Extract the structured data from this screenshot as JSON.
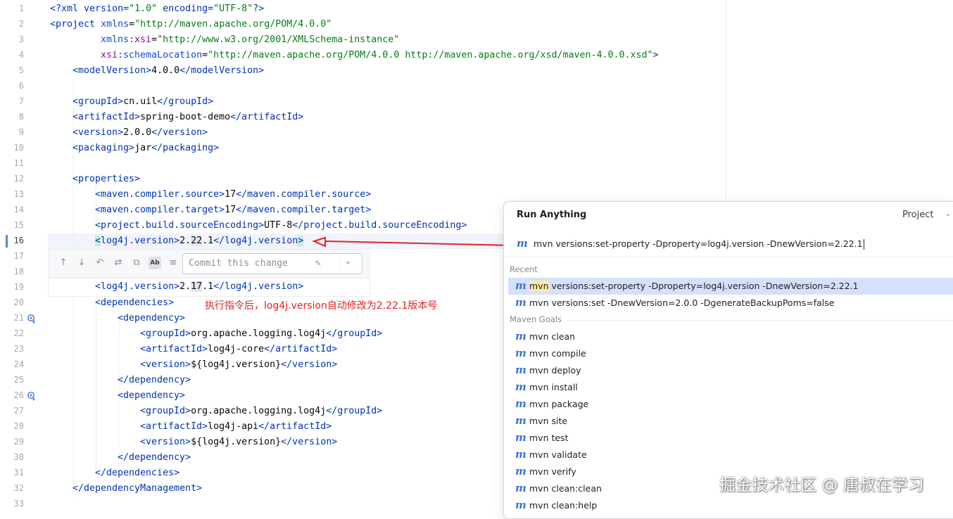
{
  "gutter": {
    "line_numbers": [
      "1",
      "2",
      "3",
      "4",
      "5",
      "6",
      "7",
      "8",
      "9",
      "10",
      "11",
      "12",
      "13",
      "14",
      "15",
      "16",
      "17",
      "18",
      "19",
      "20",
      "21",
      "22",
      "23",
      "24",
      "25",
      "26",
      "27",
      "28",
      "29",
      "30",
      "31",
      "32",
      "33"
    ],
    "current_line": "16"
  },
  "code": {
    "l1": {
      "p1": "<?xml version=",
      "p2": "\"1.0\"",
      "p3": " encoding=",
      "p4": "\"UTF-8\"",
      "p5": "?>"
    },
    "l2": {
      "p1": "<project ",
      "p2": "xmlns",
      "p3": "=",
      "p4": "\"http://maven.apache.org/POM/4.0.0\""
    },
    "l3": {
      "p1": "xmlns",
      "p2": ":xsi",
      "p3": "=",
      "p4": "\"http://www.w3.org/2001/XMLSchema-instance\""
    },
    "l4": {
      "p1": "xsi",
      "p2": ":schemaLocation",
      "p3": "=",
      "p4": "\"http://maven.apache.org/POM/4.0.0 http://maven.apache.org/xsd/maven-4.0.0.xsd\"",
      "p5": ">"
    },
    "l5": {
      "p1": "<modelVersion>",
      "p2": "4.0.0",
      "p3": "</modelVersion>"
    },
    "l7": {
      "p1": "<groupId>",
      "p2": "cn.uil",
      "p3": "</groupId>"
    },
    "l8": {
      "p1": "<artifactId>",
      "p2": "spring-boot-demo",
      "p3": "</artifactId>"
    },
    "l9": {
      "p1": "<version>",
      "p2": "2.0.0",
      "p3": "</version>"
    },
    "l10": {
      "p1": "<packaging>",
      "p2": "jar",
      "p3": "</packaging>"
    },
    "l12": {
      "p1": "<properties>"
    },
    "l13": {
      "p1": "<maven.compiler.source>",
      "p2": "17",
      "p3": "</maven.compiler.source>"
    },
    "l14": {
      "p1": "<maven.compiler.target>",
      "p2": "17",
      "p3": "</maven.compiler.target>"
    },
    "l15": {
      "p1": "<project.build.sourceEncoding>",
      "p2": "UTF-8",
      "p3": "</project.build.sourceEncoding>"
    },
    "l16": {
      "p1": "<",
      "p2": "log4j.version>",
      "p3": "2.",
      "p4": "22",
      "p5": ".1",
      "p6": "</log4j.version",
      "p7": ">"
    },
    "l19": {
      "p1": "<log4j.version>",
      "p2": "2.",
      "p3": "17",
      "p4": ".1",
      "p5": "</log4j.version>"
    },
    "l20": {
      "p1": "<dependencies>"
    },
    "l21": {
      "p1": "<dependency>"
    },
    "l22": {
      "p1": "<groupId>",
      "p2": "org.apache.logging.log4j",
      "p3": "</groupId>"
    },
    "l23": {
      "p1": "<artifactId>",
      "p2": "log4j-core",
      "p3": "</artifactId>"
    },
    "l24": {
      "p1": "<version>",
      "p2": "${log4j.version}",
      "p3": "</version>"
    },
    "l25": {
      "p1": "</dependency>"
    },
    "l26": {
      "p1": "<dependency>"
    },
    "l27": {
      "p1": "<groupId>",
      "p2": "org.apache.logging.log4j",
      "p3": "</groupId>"
    },
    "l28": {
      "p1": "<artifactId>",
      "p2": "log4j-api",
      "p3": "</artifactId>"
    },
    "l29": {
      "p1": "<version>",
      "p2": "${log4j.version}",
      "p3": "</version>"
    },
    "l30": {
      "p1": "</dependency>"
    },
    "l31": {
      "p1": "</dependencies>"
    },
    "l32": {
      "p1": "</dependencyManagement>"
    }
  },
  "diff_popup": {
    "commit_placeholder": "Commit this change",
    "toggle_label": "Ab"
  },
  "annotation": "执行指令后，log4j.version自动修改为2.22.1版本号",
  "run_anything": {
    "title": "Run Anything",
    "scope": "Project",
    "input": "mvn versions:set-property -Dproperty=log4j.version -DnewVersion=2.22.1",
    "recent_header": "Recent",
    "recent": [
      {
        "match": "mvn",
        "rest": " versions:set-property -Dproperty=log4j.version -DnewVersion=2.22.1"
      },
      {
        "match": "",
        "rest": "mvn versions:set -DnewVersion=2.0.0 -DgenerateBackupPoms=false"
      }
    ],
    "goals_header": "Maven Goals",
    "goals": [
      "mvn clean",
      "mvn compile",
      "mvn deploy",
      "mvn install",
      "mvn package",
      "mvn site",
      "mvn test",
      "mvn validate",
      "mvn verify",
      "mvn clean:clean",
      "mvn clean:help"
    ],
    "icon_glyph": "m"
  },
  "watermark": "掘金技术社区 @ 唐叔在学习",
  "colors": {
    "tag": "#0033b3",
    "attr": "#174ad4",
    "string": "#067d17",
    "namespace": "#871094",
    "annotation": "#e32222",
    "selection": "#d5e1fb"
  }
}
